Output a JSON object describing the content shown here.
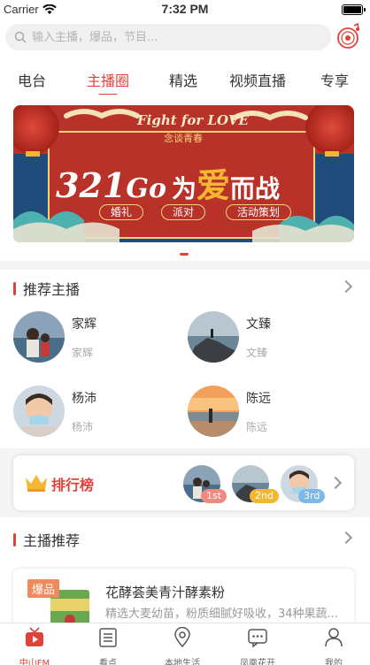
{
  "status_bar": {
    "carrier": "Carrier",
    "time": "7:32 PM",
    "battery_level": 1.0
  },
  "search": {
    "placeholder": "输入主播，爆品，节目..."
  },
  "tabs": [
    {
      "label": "电台",
      "active": false
    },
    {
      "label": "主播圈",
      "active": true
    },
    {
      "label": "精选",
      "active": false
    },
    {
      "label": "视频直播",
      "active": false
    },
    {
      "label": "专享",
      "active": false
    }
  ],
  "banner": {
    "fight_text": "Fight for LOVE",
    "sub_text": "念谈青春",
    "headline_num": "321",
    "headline_go": "Go",
    "headline_cn1": "为",
    "headline_cn2": "爱",
    "headline_cn3": "而战",
    "tags": [
      "婚礼",
      "派对",
      "活动策划"
    ]
  },
  "recommend_anchors": {
    "title": "推荐主播",
    "items": [
      {
        "name": "家辉",
        "sub": "家辉"
      },
      {
        "name": "文臻",
        "sub": "文臻"
      },
      {
        "name": "杨沛",
        "sub": "杨沛"
      },
      {
        "name": "陈远",
        "sub": "陈远"
      }
    ]
  },
  "ranking": {
    "title": "排行榜",
    "badges": [
      "1st",
      "2nd",
      "3rd"
    ]
  },
  "anchor_recommend": {
    "title": "主播推荐",
    "product": {
      "tag": "爆品",
      "name": "花酵荟美青汁酵素粉",
      "desc": "精选大麦幼苗，粉质细腻好吸收，34种果蔬..."
    }
  },
  "tabbar": [
    {
      "label": "中山FM",
      "icon": "radio-tv-icon",
      "active": true
    },
    {
      "label": "看点",
      "icon": "list-icon",
      "active": false
    },
    {
      "label": "本地生活",
      "icon": "location-icon",
      "active": false
    },
    {
      "label": "凤凰花开",
      "icon": "chat-icon",
      "active": false
    },
    {
      "label": "我的",
      "icon": "user-icon",
      "active": false
    }
  ],
  "colors": {
    "accent": "#e0423a",
    "banner_red": "#b8322a",
    "gold": "#f5b731"
  }
}
